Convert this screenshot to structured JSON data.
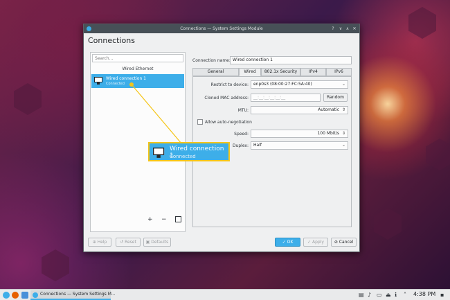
{
  "window": {
    "title": "Connections — System Settings Module",
    "page_title": "Connections",
    "controls": [
      "?",
      "∨",
      "∧",
      "✕"
    ]
  },
  "left_panel": {
    "search_placeholder": "Search...",
    "section_header": "Wired Ethernet",
    "connection": {
      "name": "Wired connection 1",
      "status": "Connected"
    },
    "tools": [
      "+",
      "−"
    ]
  },
  "form": {
    "connection_name_label": "Connection name:",
    "connection_name_value": "Wired connection 1",
    "tabs": [
      "General configuration",
      "Wired",
      "802.1x Security",
      "IPv4",
      "IPv6"
    ],
    "active_tab": "Wired",
    "restrict_label": "Restrict to device:",
    "restrict_value": "enp0s3 (08:00:27:FC:5A:40)",
    "cloned_mac_label": "Cloned MAC address:",
    "cloned_mac_placeholder": "__:__:__:__:__:__",
    "random_button": "Random",
    "mtu_label": "MTU:",
    "mtu_value": "Automatic",
    "auto_neg_label": "Allow auto-negotiation",
    "speed_label": "Speed:",
    "speed_value": "100 Mbit/s",
    "duplex_label": "Duplex:",
    "duplex_value": "Half"
  },
  "footer": {
    "help": "Help",
    "reset": "Reset",
    "defaults": "Defaults",
    "ok": "OK",
    "apply": "Apply",
    "cancel": "Cancel"
  },
  "callout": {
    "name": "Wired connection 1",
    "status": "Connected"
  },
  "taskbar": {
    "task_label": "Connections — System Settings M...",
    "clock": "4:38 PM"
  },
  "colors": {
    "accent": "#3daee9",
    "callout_border": "#f5c518",
    "titlebar": "#475057"
  }
}
